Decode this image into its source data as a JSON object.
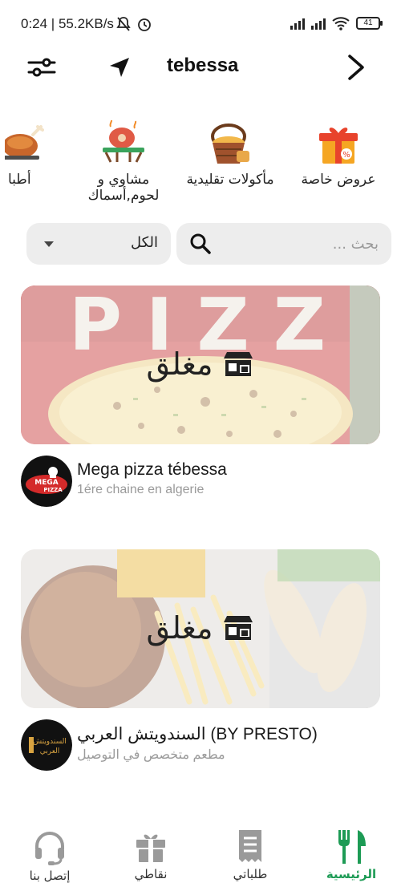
{
  "status_bar": {
    "time_speed": "0:24 | 55.2KB/s",
    "battery": "41"
  },
  "header": {
    "city": "tebessa"
  },
  "categories": [
    {
      "label": "عروض خاصة",
      "icon": "gift-box-icon"
    },
    {
      "label": "مأكولات تقليدية",
      "icon": "bread-basket-icon"
    },
    {
      "label_line1": "مشاوي و",
      "label_line2": "لحوم,أسماك",
      "icon": "grilled-meat-icon"
    },
    {
      "label": "أطبا",
      "icon": "roast-chicken-icon"
    }
  ],
  "filter": {
    "selected": "الكل"
  },
  "search": {
    "placeholder": "بحث ..."
  },
  "restaurants": [
    {
      "name": "Mega pizza tébessa",
      "description": "1ére chaine en algerie",
      "status": "مغلق",
      "logo_text_1": "MEGA",
      "logo_text_2": "PIZZA"
    },
    {
      "name": "السندويتش العربي (BY PRESTO)",
      "description": "مطعم متخصص في التوصيل",
      "status": "مغلق",
      "logo_text_1": "السندويتش",
      "logo_text_2": "العربي"
    }
  ],
  "bottom_nav": [
    {
      "label": "إتصل بنا",
      "icon": "headset-icon"
    },
    {
      "label": "نقاطي",
      "icon": "gift-icon"
    },
    {
      "label": "طلباتي",
      "icon": "receipt-icon"
    },
    {
      "label": "الرئيسية",
      "icon": "fork-knife-icon"
    }
  ],
  "colors": {
    "accent": "#1d9b55",
    "surface": "#ededed"
  }
}
